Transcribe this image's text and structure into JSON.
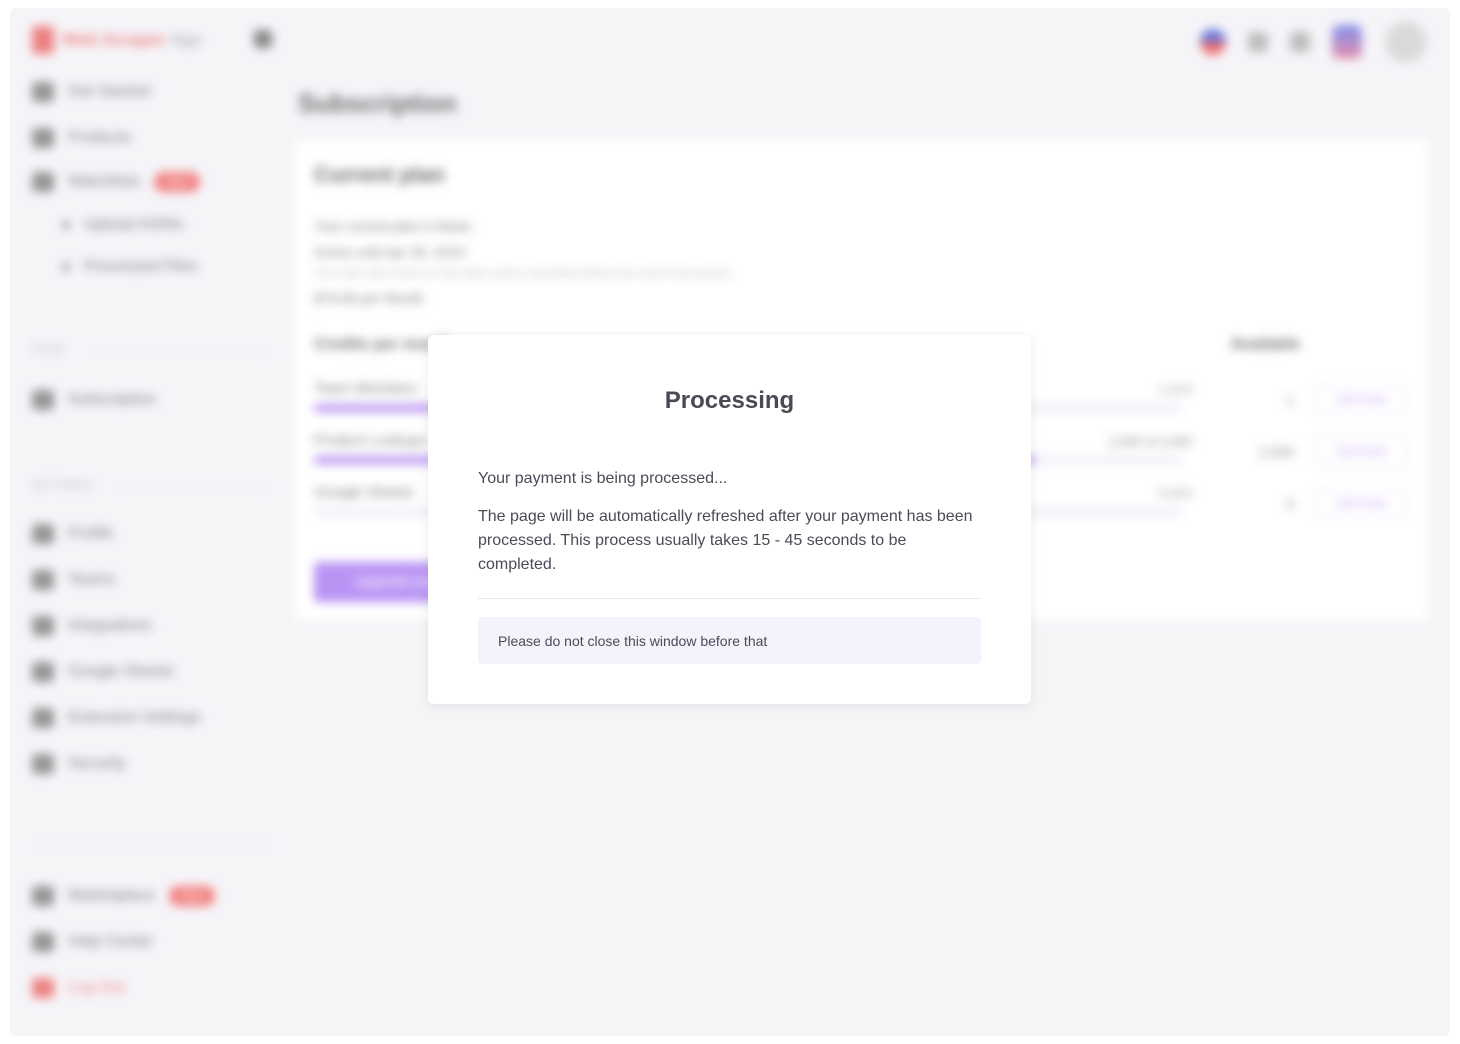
{
  "brand": {
    "name": "Web Scraper",
    "suffix": "App"
  },
  "sidebar": {
    "items": [
      {
        "label": "Get Started",
        "icon": "rocket-icon"
      },
      {
        "label": "Products",
        "icon": "box-icon"
      },
      {
        "label": "Watchlists",
        "icon": "list-icon",
        "badge": "New"
      },
      {
        "label": "Upload ASINs",
        "icon": "dot-icon"
      },
      {
        "label": "Processed Files",
        "icon": "dot-icon"
      }
    ],
    "section_plan": "Plan",
    "plan_item": {
      "label": "Subscription",
      "icon": "card-icon"
    },
    "section_settings": "Settings",
    "settings_items": [
      {
        "label": "Profile",
        "icon": "user-icon"
      },
      {
        "label": "Teams",
        "icon": "team-icon"
      },
      {
        "label": "Integrations",
        "icon": "plug-icon"
      },
      {
        "label": "Google Sheets",
        "icon": "sheet-icon"
      },
      {
        "label": "Extension Settings",
        "icon": "puzzle-icon"
      },
      {
        "label": "Security",
        "icon": "shield-icon"
      }
    ],
    "bottom_items": [
      {
        "label": "Marketplace",
        "icon": "store-icon",
        "badge": "New"
      },
      {
        "label": "Help Center",
        "icon": "help-icon"
      }
    ],
    "logout": "Log Out"
  },
  "main": {
    "title": "Subscription",
    "card_title": "Current plan",
    "plan_current": "Your current plan is Basic",
    "plan_active": "Active until Apr 30, 2023",
    "plan_note": "Your plan will renew on this date unless cancelled before the end of the period.",
    "plan_price": "$79.99 per Month",
    "usage_head": "Credits per month",
    "available_head": "Available",
    "rows": [
      {
        "label": "Team Members",
        "amount": "1 of 3",
        "available": "1",
        "fill": 0.33,
        "action": "Get more"
      },
      {
        "label": "Product Lookups",
        "amount": "2,500 of 3,000",
        "available": "2,500",
        "fill": 0.83,
        "action": "Get more"
      },
      {
        "label": "Google Sheets",
        "amount": "0 of 5",
        "available": "5",
        "fill": 0.0,
        "action": "Get more"
      }
    ],
    "upgrade_label": "Upgrade plan"
  },
  "modal": {
    "title": "Processing",
    "line1": "Your payment is being processed...",
    "line2": "The page will be automatically refreshed after your payment has been processed. This process usually takes 15 - 45 seconds to be completed.",
    "note": "Please do not close this window before that"
  },
  "colors": {
    "accent": "#a777f2",
    "danger": "#e85d5d",
    "background": "#f3f2f7",
    "note_bg": "#f5f2fd"
  }
}
